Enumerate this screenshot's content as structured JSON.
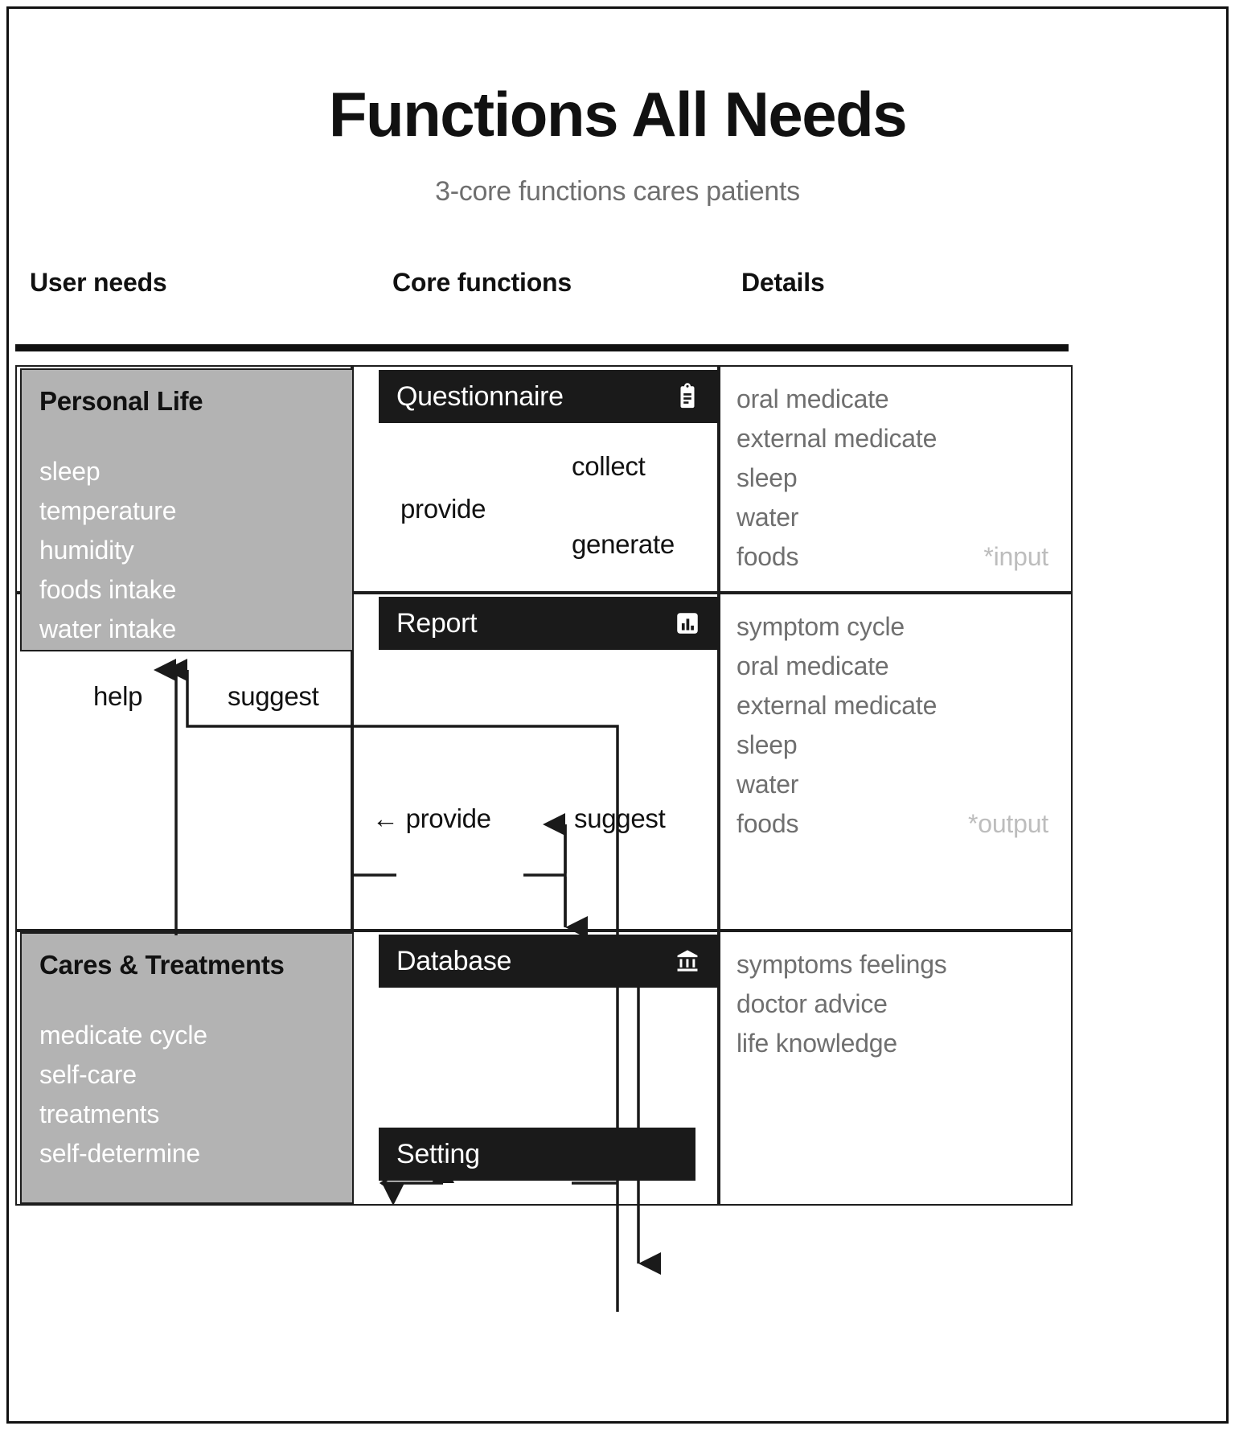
{
  "header": {
    "title": "Functions All Needs",
    "subtitle": "3-core functions cares patients"
  },
  "columns": {
    "user_needs": "User needs",
    "core_functions": "Core functions",
    "details": "Details"
  },
  "user_needs_boxes": [
    {
      "title": "Personal Life",
      "items": [
        "sleep",
        "temperature",
        "humidity",
        "foods intake",
        "water intake"
      ]
    },
    {
      "title": "Cares & Treatments",
      "items": [
        "medicate cycle",
        "self-care",
        "treatments",
        "self-determine"
      ]
    }
  ],
  "core_functions": [
    {
      "label": "Questionnaire",
      "icon": "clipboard-icon"
    },
    {
      "label": "Report",
      "icon": "bar-chart-icon"
    },
    {
      "label": "Database",
      "icon": "bank-icon"
    },
    {
      "label": "Setting",
      "icon": "none"
    }
  ],
  "details": [
    {
      "items": [
        "oral medicate",
        "external medicate",
        "sleep",
        "water",
        "foods"
      ],
      "tag": "*input",
      "tag_row": 4
    },
    {
      "items": [
        "symptom cycle",
        "oral medicate",
        "external medicate",
        "sleep",
        "water",
        "foods"
      ],
      "tag": "*output",
      "tag_row": 5
    },
    {
      "items": [
        "symptoms feelings",
        "doctor advice",
        "life knowledge"
      ],
      "tag": "",
      "tag_row": -1
    }
  ],
  "connectors": {
    "provide_to_questionnaire": "provide",
    "collect": "collect",
    "generate": "generate",
    "help": "help",
    "suggest_to_needs": "suggest",
    "provide_from_database": "← provide",
    "suggest_to_database": "suggest"
  },
  "colors": {
    "ink": "#111111",
    "panel_dark": "#1a1a1a",
    "need_gray": "#b3b3b3",
    "detail_gray": "#6f6f6f",
    "tag_gray": "#bdbdbd",
    "background": "#ffffff"
  }
}
